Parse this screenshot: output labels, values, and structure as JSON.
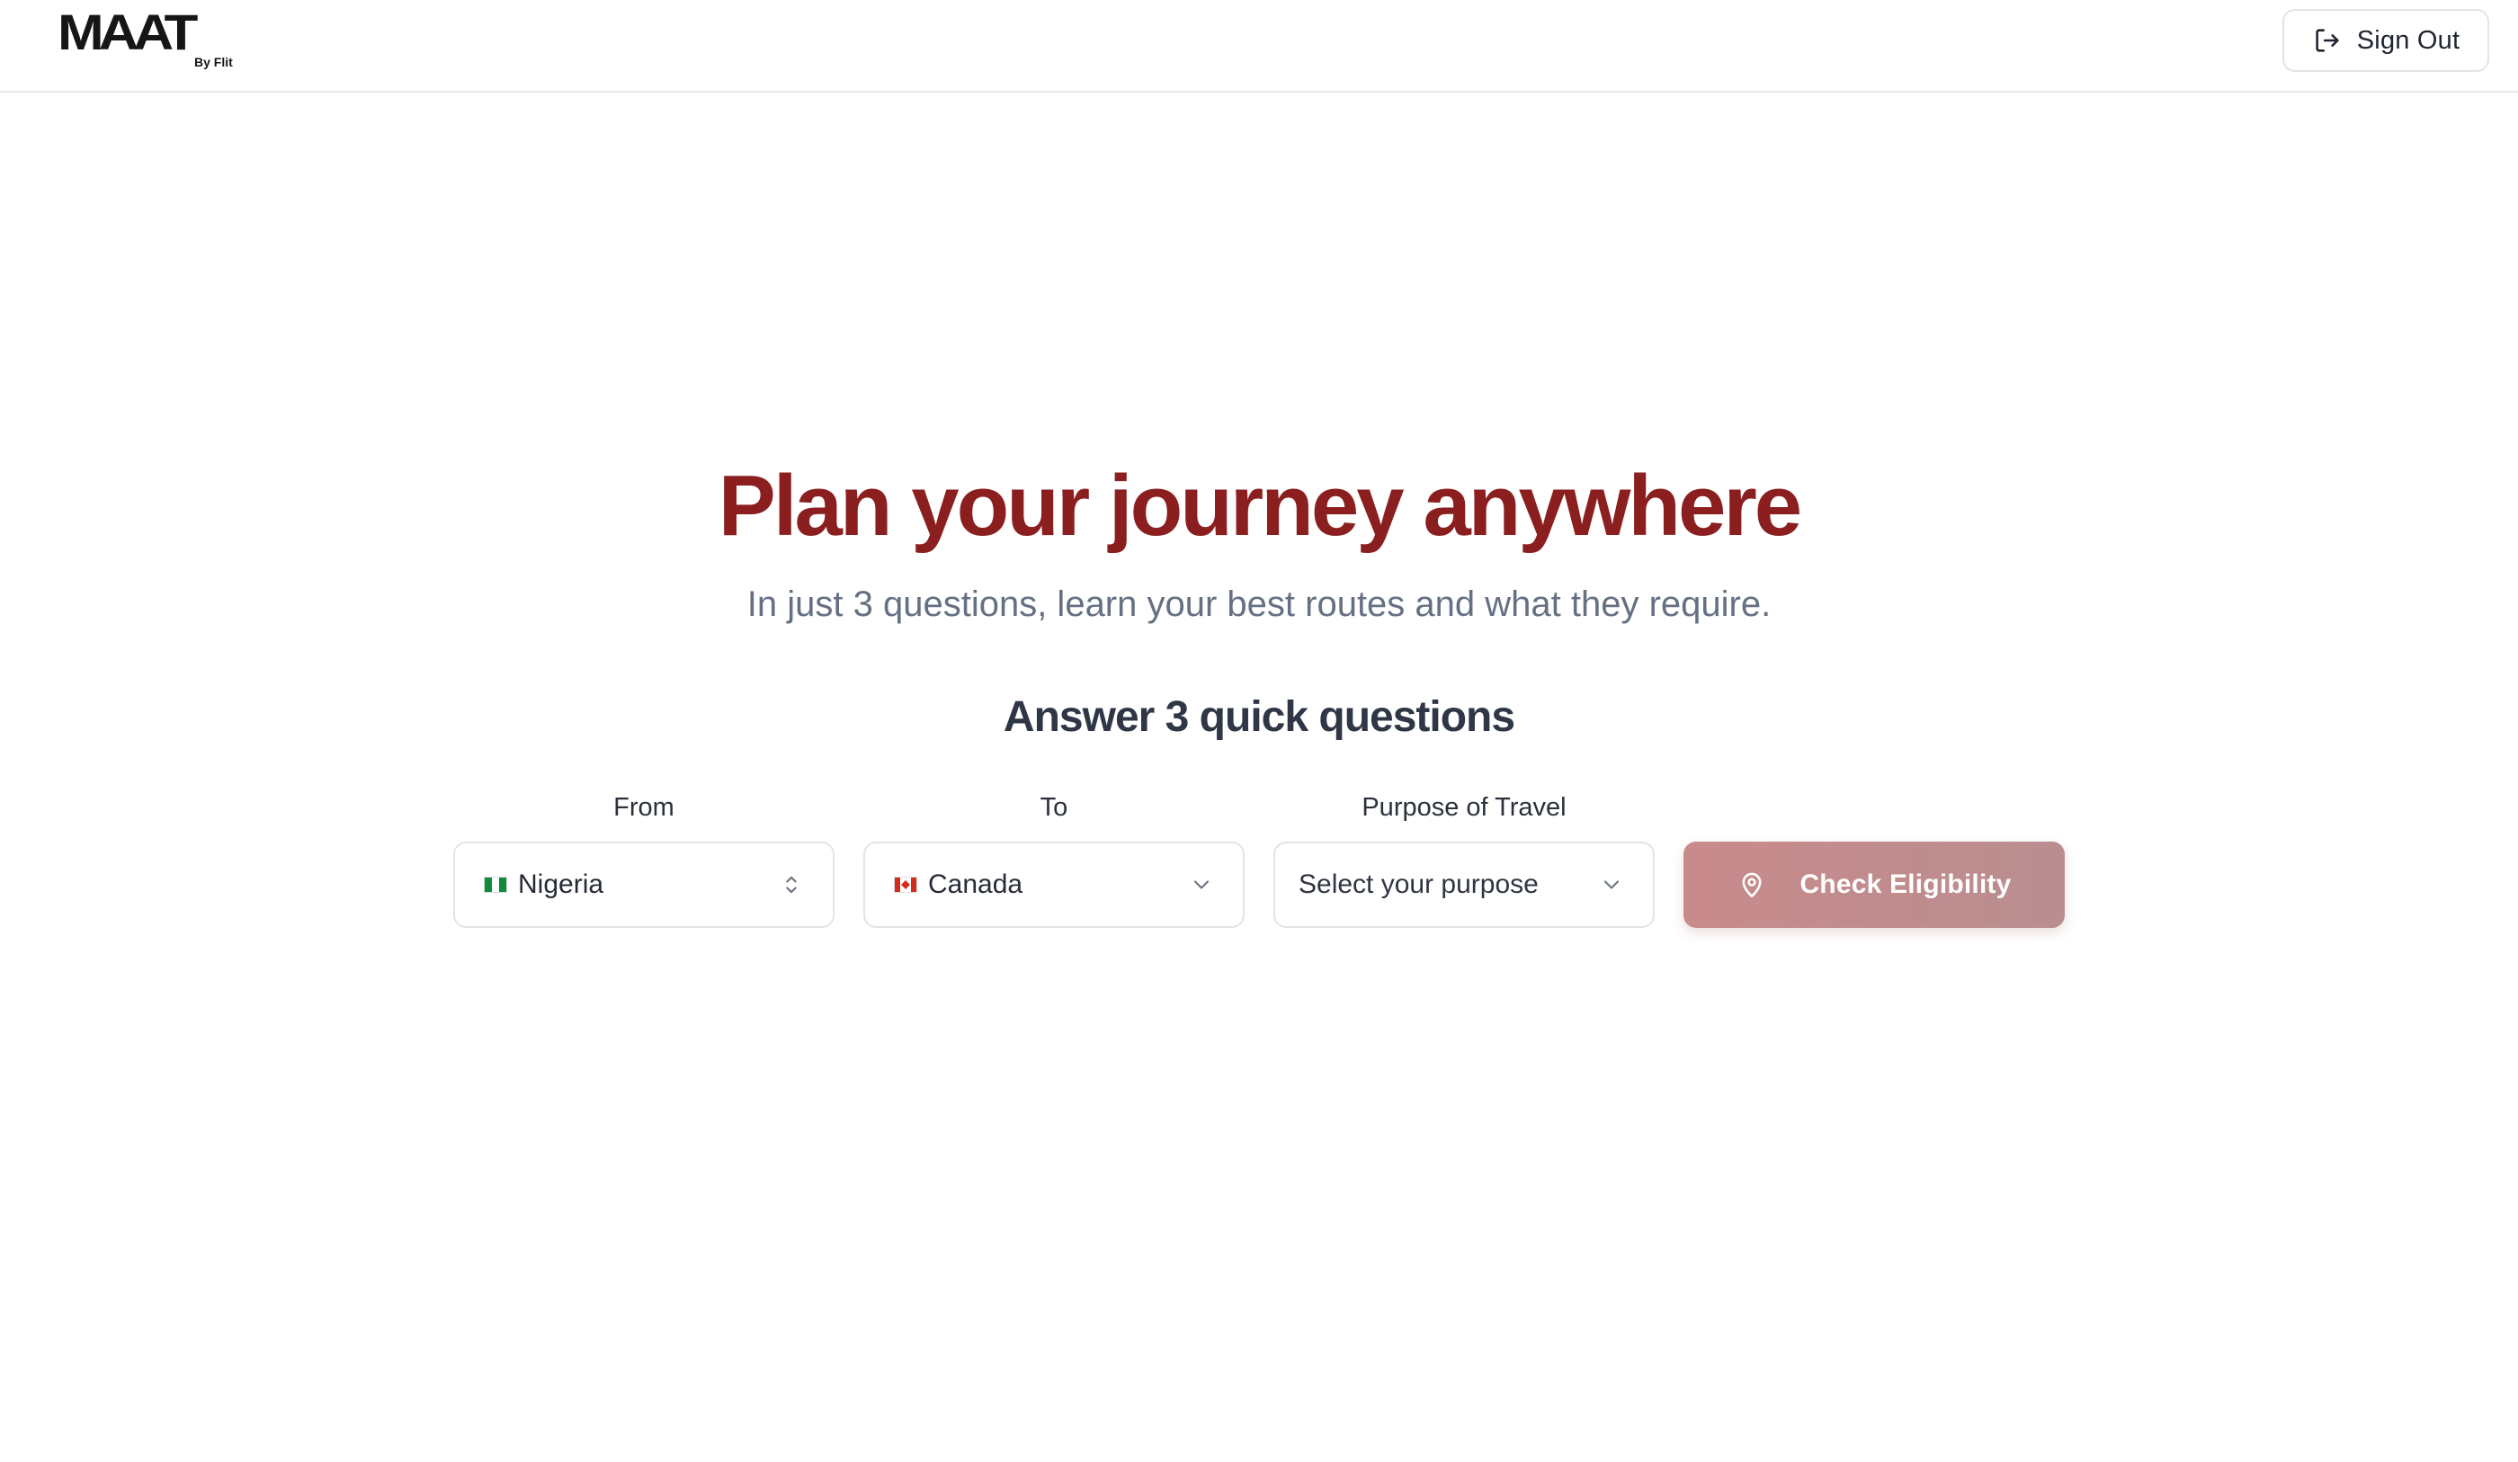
{
  "header": {
    "logo_text": "MAAT",
    "logo_sub": "By Flit",
    "signout_label": "Sign Out"
  },
  "hero": {
    "title": "Plan your journey anywhere",
    "subtitle": "In just 3 questions, learn your best routes and what they require."
  },
  "questions": {
    "title": "Answer 3 quick questions",
    "from": {
      "label": "From",
      "value": "Nigeria",
      "flag": "nigeria-flag-icon"
    },
    "to": {
      "label": "To",
      "value": "Canada",
      "flag": "canada-flag-icon"
    },
    "purpose": {
      "label": "Purpose of Travel",
      "placeholder": "Select your purpose"
    },
    "submit_label": "Check Eligibility"
  },
  "colors": {
    "brand": "#8b1f1f",
    "cta": "#c98a8c",
    "subtitle": "#657083",
    "heading": "#2f3747"
  }
}
